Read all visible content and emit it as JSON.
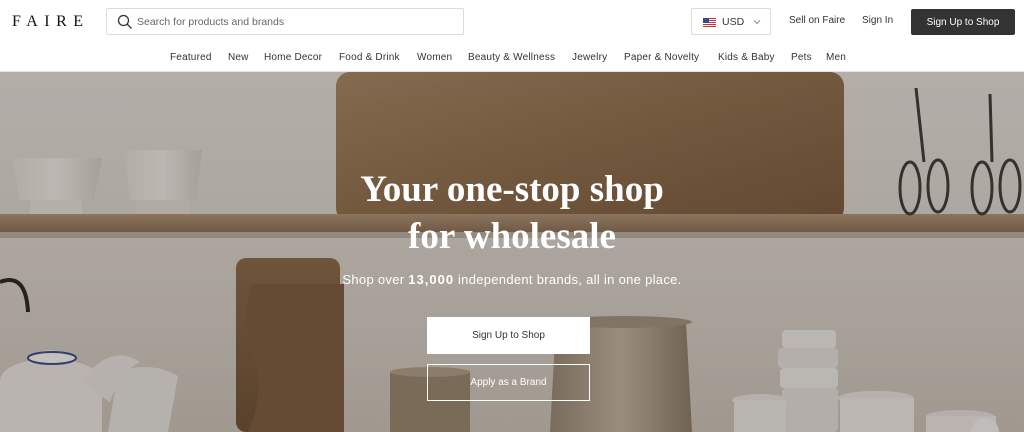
{
  "header": {
    "logo": "FAIRE",
    "search": {
      "placeholder": "Search for products and brands",
      "value": "",
      "icon": "search-icon"
    },
    "currency": {
      "code": "USD",
      "flag_icon": "us-flag-icon"
    },
    "links": {
      "sell": "Sell on Faire",
      "signin": "Sign In"
    },
    "signup_label": "Sign Up to Shop"
  },
  "categories": [
    "Featured",
    "New",
    "Home Decor",
    "Food & Drink",
    "Women",
    "Beauty & Wellness",
    "Jewelry",
    "Paper & Novelty",
    "Kids & Baby",
    "Pets",
    "Men"
  ],
  "hero": {
    "title_line1": "Your one-stop shop",
    "title_line2": "for wholesale",
    "subtitle_pre": "Shop over ",
    "subtitle_count": "13,000",
    "subtitle_post": " independent brands, all in one place.",
    "primary_cta": "Sign Up to Shop",
    "secondary_cta": "Apply as a Brand"
  },
  "colors": {
    "dark_button": "#333333",
    "text": "#333333",
    "hero_text": "#ffffff"
  }
}
